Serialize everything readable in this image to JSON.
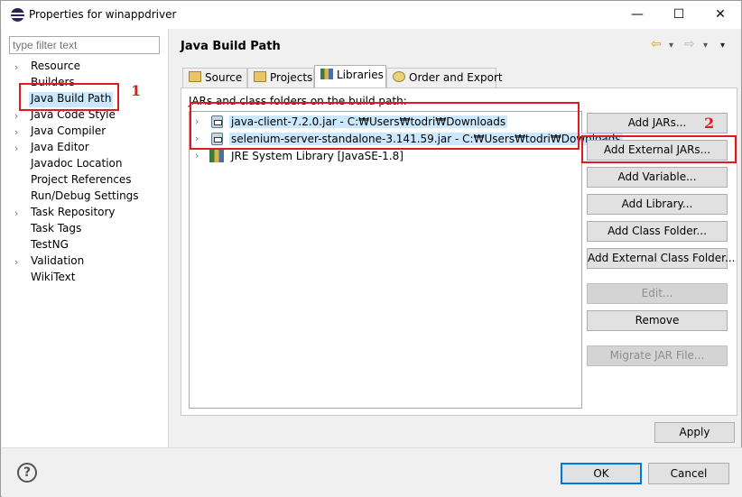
{
  "window": {
    "title": "Properties for winappdriver",
    "minimize": "—",
    "maximize": "☐",
    "close": "✕"
  },
  "filter": {
    "placeholder": "type filter text"
  },
  "nav": {
    "items": [
      {
        "label": "Resource",
        "expandable": true
      },
      {
        "label": "Builders",
        "expandable": false
      },
      {
        "label": "Java Build Path",
        "expandable": false,
        "selected": true
      },
      {
        "label": "Java Code Style",
        "expandable": true
      },
      {
        "label": "Java Compiler",
        "expandable": true
      },
      {
        "label": "Java Editor",
        "expandable": true
      },
      {
        "label": "Javadoc Location",
        "expandable": false
      },
      {
        "label": "Project References",
        "expandable": false
      },
      {
        "label": "Run/Debug Settings",
        "expandable": false
      },
      {
        "label": "Task Repository",
        "expandable": true
      },
      {
        "label": "Task Tags",
        "expandable": false
      },
      {
        "label": "TestNG",
        "expandable": false
      },
      {
        "label": "Validation",
        "expandable": true
      },
      {
        "label": "WikiText",
        "expandable": false
      }
    ]
  },
  "page": {
    "title": "Java Build Path",
    "back": "⇦",
    "forward": "⇨",
    "menu": "▾"
  },
  "tabs": [
    {
      "label": "Source",
      "icon": "source-folder-icon"
    },
    {
      "label": "Projects",
      "icon": "projects-folder-icon"
    },
    {
      "label": "Libraries",
      "icon": "libraries-icon",
      "active": true
    },
    {
      "label": "Order and Export",
      "icon": "order-export-icon"
    }
  ],
  "libraries": {
    "label": "JARs and class folders on the build path:",
    "entries": [
      {
        "label": "java-client-7.2.0.jar - C:₩Users₩todri₩Downloads",
        "icon": "jar-icon",
        "selected": true
      },
      {
        "label": "selenium-server-standalone-3.141.59.jar - C:₩Users₩todri₩Downloads",
        "icon": "jar-icon",
        "selected": true
      },
      {
        "label": "JRE System Library [JavaSE-1.8]",
        "icon": "library-icon",
        "selected": false
      }
    ]
  },
  "buttons": {
    "add_jars": "Add JARs...",
    "add_external_jars": "Add External JARs...",
    "add_variable": "Add Variable...",
    "add_library": "Add Library...",
    "add_class_folder": "Add Class Folder...",
    "add_external_class_folder": "Add External Class Folder...",
    "edit": "Edit...",
    "remove": "Remove",
    "migrate_jar": "Migrate JAR File...",
    "apply": "Apply",
    "ok": "OK",
    "cancel": "Cancel",
    "help": "?"
  },
  "annotations": {
    "one": "1",
    "two": "2",
    "color": "#e01b1b"
  },
  "colors": {
    "selection": "#cce8ff",
    "accent": "#0078d7"
  }
}
